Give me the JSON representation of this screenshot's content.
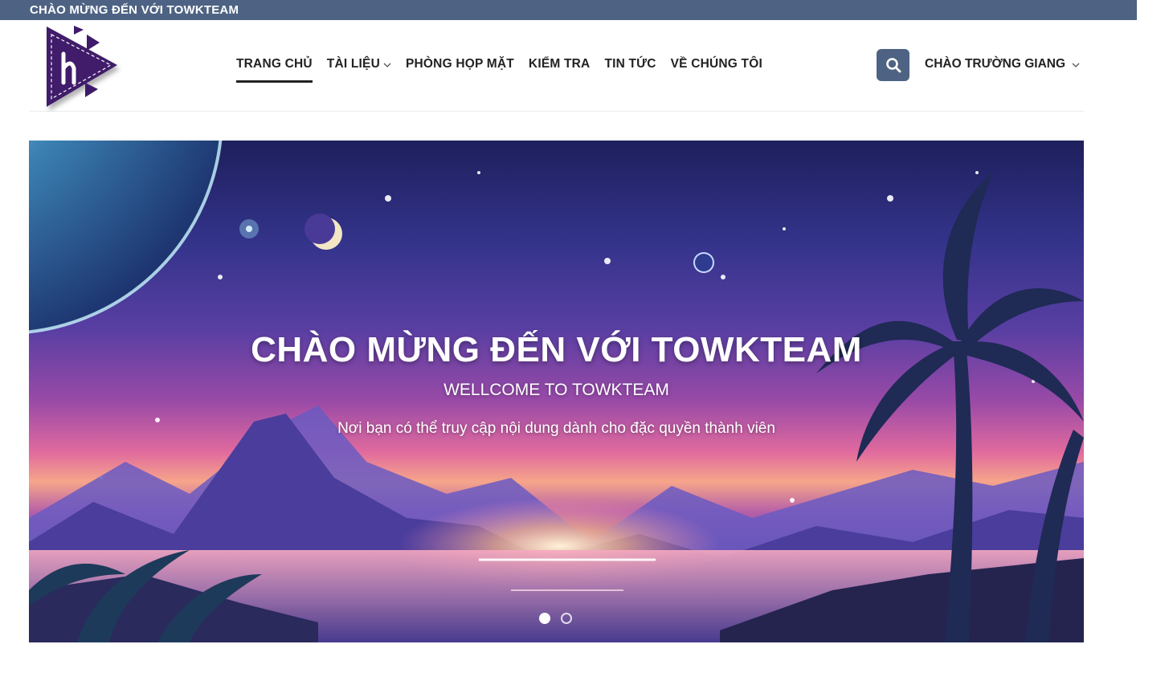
{
  "topbar": {
    "text": "CHÀO MỪNG ĐẾN VỚI TOWKTEAM"
  },
  "colors": {
    "brand": "#4e6383",
    "logo": "#3f1a6b"
  },
  "nav": {
    "items": [
      {
        "label": "TRANG CHỦ",
        "active": true,
        "has_dropdown": false
      },
      {
        "label": "TÀI LIỆU",
        "active": false,
        "has_dropdown": true
      },
      {
        "label": "PHÒNG HỌP MẶT",
        "active": false,
        "has_dropdown": false
      },
      {
        "label": "KIỂM TRA",
        "active": false,
        "has_dropdown": false
      },
      {
        "label": "TIN TỨC",
        "active": false,
        "has_dropdown": false
      },
      {
        "label": "VỀ CHÚNG TÔI",
        "active": false,
        "has_dropdown": false
      }
    ]
  },
  "header": {
    "search_icon": "search-icon",
    "account_label": "CHÀO TRƯỜNG GIANG"
  },
  "hero": {
    "title": "CHÀO MỪNG ĐẾN VỚI TOWKTEAM",
    "subtitle": "WELLCOME TO TOWKTEAM",
    "description": "Nơi bạn có thể truy cập nội dung dành cho đặc quyền thành viên",
    "slides": [
      {
        "active": true
      },
      {
        "active": false
      }
    ]
  }
}
